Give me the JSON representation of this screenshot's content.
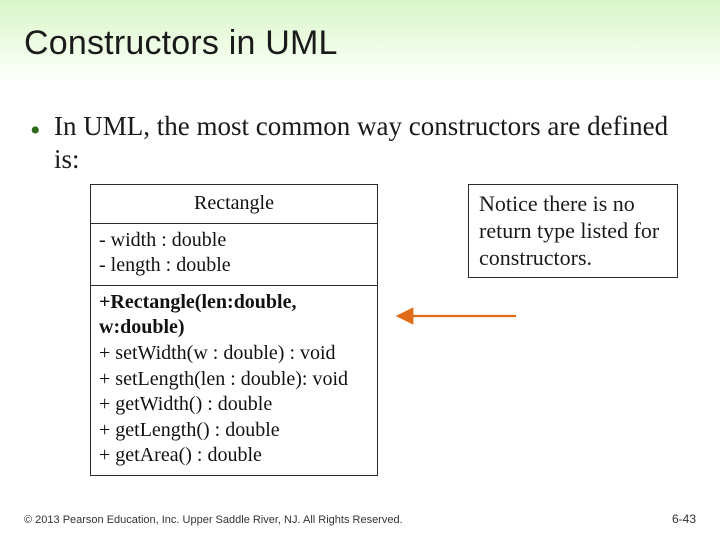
{
  "title": "Constructors in UML",
  "bullet": "In UML, the most common way constructors are defined is:",
  "uml": {
    "class_name": "Rectangle",
    "attributes": [
      "- width : double",
      "- length : double"
    ],
    "operations": [
      "+Rectangle(len:double, w:double)",
      "+ setWidth(w : double) : void",
      "+ setLength(len : double): void",
      "+ getWidth() : double",
      "+ getLength() : double",
      "+ getArea() : double"
    ]
  },
  "notice": "Notice there is no return type listed for constructors.",
  "footer_left": "© 2013 Pearson Education, Inc. Upper Saddle River, NJ. All Rights Reserved.",
  "footer_right": "6-43"
}
